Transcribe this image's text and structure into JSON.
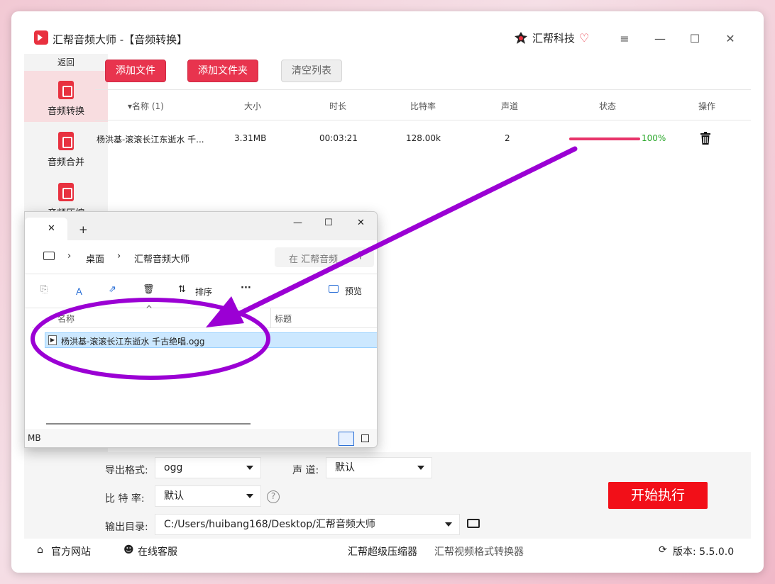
{
  "window": {
    "app_title": "汇帮音频大师 -【音频转换】",
    "brand": "汇帮科技",
    "controls": {
      "menu": "≡",
      "minimize": "—",
      "maximize": "☐",
      "close": "✕"
    }
  },
  "sidebar": {
    "back": "返回",
    "items": [
      {
        "label": "音频转换",
        "active": true
      },
      {
        "label": "音频合并",
        "active": false
      },
      {
        "label": "音频压缩",
        "active": false
      }
    ]
  },
  "toolbar": {
    "add_file": "添加文件",
    "add_folder": "添加文件夹",
    "clear_list": "清空列表"
  },
  "table": {
    "headers": [
      "▾名称 (1)",
      "大小",
      "时长",
      "比特率",
      "声道",
      "状态",
      "操作"
    ],
    "rows": [
      {
        "name": "杨洪基-滚滚长江东逝水 千...",
        "size": "3.31MB",
        "duration": "00:03:21",
        "bitrate": "128.00k",
        "channels": "2",
        "progress": "100%"
      }
    ]
  },
  "settings": {
    "format_label": "导出格式:",
    "format_value": "ogg",
    "channel_label": "声 道:",
    "channel_value": "默认",
    "bitrate_label": "比 特 率:",
    "bitrate_value": "默认",
    "help": "?",
    "output_label": "输出目录:",
    "output_value": "C:/Users/huibang168/Desktop/汇帮音频大师",
    "start": "开始执行"
  },
  "footer": {
    "website": "官方网站",
    "support": "在线客服",
    "compressor": "汇帮超级压缩器",
    "video_converter": "汇帮视频格式转换器",
    "version": "版本: 5.5.0.0"
  },
  "explorer": {
    "tab_close": "✕",
    "tab_new": "+",
    "win_min": "—",
    "win_max": "☐",
    "win_close": "✕",
    "crumb_1": "桌面",
    "crumb_2": "汇帮音频大师",
    "search_placeholder": "在 汇帮音频",
    "sort": "排序",
    "more": "···",
    "preview": "预览",
    "col_name": "名称",
    "col_title": "标题",
    "file": "杨洪基-滚滚长江东逝水  千古绝唱.ogg",
    "status": "MB"
  },
  "colors": {
    "accent_red": "#e8344e",
    "start_red": "#f20f18",
    "annotation_purple": "#9b00d4",
    "progress_pink": "#e8346a",
    "ok_green": "#2aa82a"
  }
}
